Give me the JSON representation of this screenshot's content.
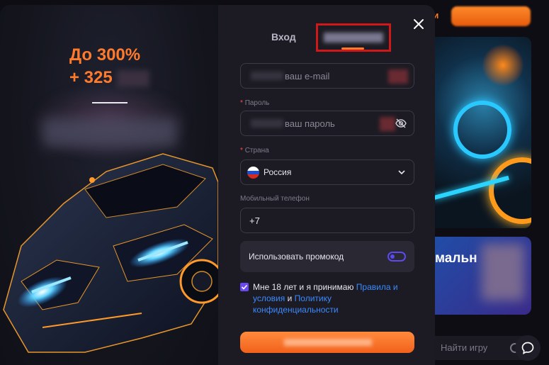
{
  "background": {
    "top_text": "ти",
    "card2_text": "мальн",
    "search_placeholder": "Найти игру"
  },
  "promo": {
    "line1": "До 300%",
    "line2": "+ 325"
  },
  "tabs": {
    "login": "Вход"
  },
  "form": {
    "email_placeholder": "ваш e-mail",
    "password_label": "Пароль",
    "password_placeholder": "ваш пароль",
    "country_label": "Страна",
    "country_value": "Россия",
    "phone_label": "Мобильный телефон",
    "phone_value": "+7",
    "promo_toggle_label": "Использовать промокод",
    "required_mark": "*",
    "agree_prefix": "Мне 18 лет и я принимаю",
    "agree_link1": "Правила и условия",
    "agree_and": "и",
    "agree_link2": "Политику конфиденциальности"
  },
  "colors": {
    "accent": "#ff7a2a",
    "link": "#3a8aff",
    "toggle": "#5a4aef",
    "highlight_box": "#d01818"
  }
}
